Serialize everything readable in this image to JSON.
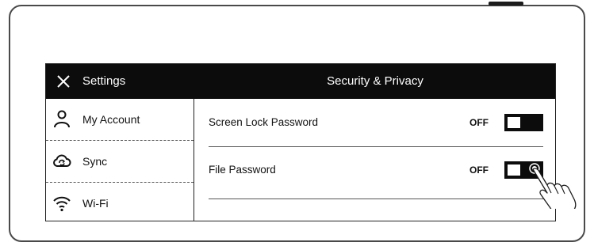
{
  "header": {
    "settings_label": "Settings",
    "page_title": "Security & Privacy"
  },
  "sidebar": {
    "items": [
      {
        "label": "My Account",
        "icon": "user-icon"
      },
      {
        "label": "Sync",
        "icon": "cloud-sync-icon"
      },
      {
        "label": "Wi-Fi",
        "icon": "wifi-icon"
      }
    ]
  },
  "settings": [
    {
      "label": "Screen Lock Password",
      "state": "OFF",
      "on": false
    },
    {
      "label": "File Password",
      "state": "OFF",
      "on": false
    }
  ],
  "colors": {
    "bar": "#0c0c0c",
    "background": "#ffffff",
    "text": "#111111"
  }
}
